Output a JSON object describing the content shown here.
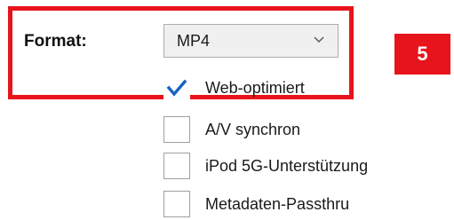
{
  "format": {
    "label": "Format:",
    "selected": "MP4",
    "chevron_icon": "chevron-down-icon"
  },
  "options": [
    {
      "label": "Web-optimiert",
      "checked": true
    },
    {
      "label": "A/V synchron",
      "checked": false
    },
    {
      "label": "iPod 5G-Unterstützung",
      "checked": false
    },
    {
      "label": "Metadaten-Passthru",
      "checked": false
    }
  ],
  "annotation": {
    "step_number": "5",
    "color": "#e8141b"
  },
  "colors": {
    "checkmark": "#1a62c4"
  }
}
